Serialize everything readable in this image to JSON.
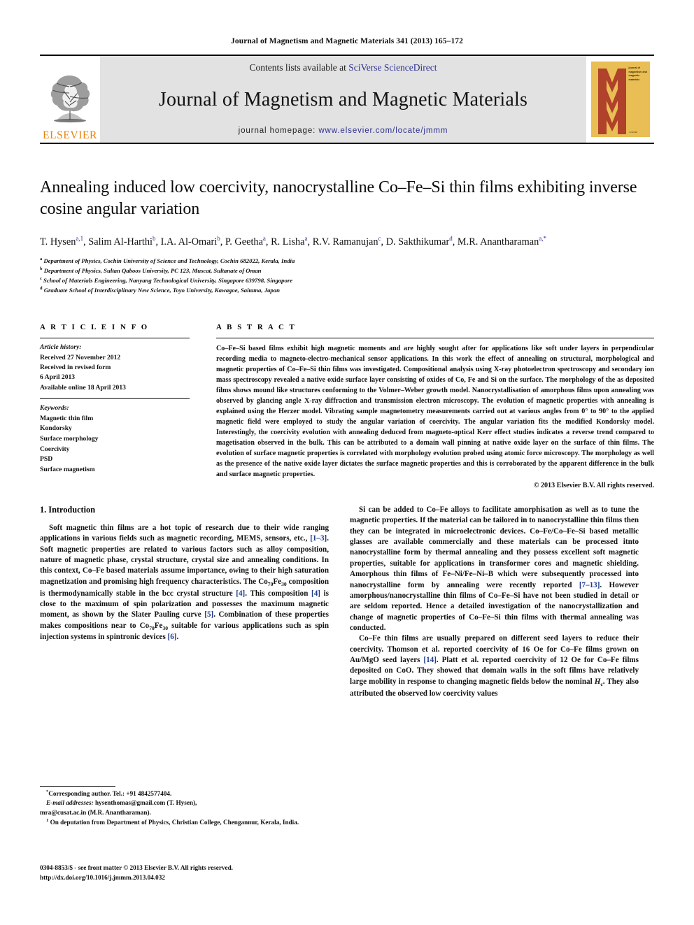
{
  "running_head": "Journal of Magnetism and Magnetic Materials 341 (2013) 165–172",
  "masthead": {
    "publisher_name": "ELSEVIER",
    "contents_prefix": "Contents lists available at ",
    "contents_link": "SciVerse ScienceDirect",
    "journal_title": "Journal of Magnetism and Magnetic Materials",
    "homepage_label": "journal homepage: ",
    "homepage_url": "www.elsevier.com/locate/jmmm",
    "cover_text": "journal of magnetism and magnetic materials",
    "cover_bottom_text": "ELSEVIER",
    "cover_bg": "#E8BE55",
    "cover_mark": "#B0412A"
  },
  "article": {
    "title": "Annealing induced low coercivity, nanocrystalline Co–Fe–Si thin films exhibiting inverse cosine angular variation",
    "authors_line_1": "T. Hysen",
    "authors": [
      {
        "name": "T. Hysen",
        "marks": "a,1"
      },
      {
        "name": "Salim Al-Harthi",
        "marks": "b"
      },
      {
        "name": "I.A. Al-Omari",
        "marks": "b"
      },
      {
        "name": "P. Geetha",
        "marks": "a"
      },
      {
        "name": "R. Lisha",
        "marks": "a"
      },
      {
        "name": "R.V. Ramanujan",
        "marks": "c"
      },
      {
        "name": "D. Sakthikumar",
        "marks": "d"
      },
      {
        "name": "M.R. Anantharaman",
        "marks": "a,*"
      }
    ],
    "affiliations": [
      {
        "mark": "a",
        "text": "Department of Physics, Cochin University of Science and Technology, Cochin 682022, Kerala, India"
      },
      {
        "mark": "b",
        "text": "Department of Physics, Sultan Qaboos University, PC 123, Muscat, Sultanate of Oman"
      },
      {
        "mark": "c",
        "text": "School of Materials Engineering, Nanyang Technological University, Singapore 639798, Singapore"
      },
      {
        "mark": "d",
        "text": "Graduate School of Interdisciplinary New Science, Toyo University, Kawagoe, Saitama, Japan"
      }
    ]
  },
  "article_info": {
    "heading": "A R T I C L E   I N F O",
    "history_label": "Article history:",
    "history": [
      "Received 27 November 2012",
      "Received in revised form",
      "6 April 2013",
      "Available online 18 April 2013"
    ],
    "keywords_label": "Keywords:",
    "keywords": [
      "Magnetic thin film",
      "Kondorsky",
      "Surface morphology",
      "Coercivity",
      "PSD",
      "Surface magnetism"
    ]
  },
  "abstract": {
    "heading": "A B S T R A C T",
    "text": "Co–Fe–Si based films exhibit high magnetic moments and are highly sought after for applications like soft under layers in perpendicular recording media to magneto-electro-mechanical sensor applications. In this work the effect of annealing on structural, morphological and magnetic properties of Co–Fe–Si thin films was investigated. Compositional analysis using X-ray photoelectron spectroscopy and secondary ion mass spectroscopy revealed a native oxide surface layer consisting of oxides of Co, Fe and Si on the surface. The morphology of the as deposited films shows mound like structures conforming to the Volmer–Weber growth model. Nanocrystallisation of amorphous films upon annealing was observed by glancing angle X-ray diffraction and transmission electron microscopy. The evolution of magnetic properties with annealing is explained using the Herzer model. Vibrating sample magnetometry measurements carried out at various angles from 0° to 90° to the applied magnetic field were employed to study the angular variation of coercivity. The angular variation fits the modified Kondorsky model. Interestingly, the coercivity evolution with annealing deduced from magneto-optical Kerr effect studies indicates a reverse trend compared to magetisation observed in the bulk. This can be attributed to a domain wall pinning at native oxide layer on the surface of thin films. The evolution of surface magnetic properties is correlated with morphology evolution probed using atomic force microscopy. The morphology as well as the presence of the native oxide layer dictates the surface magnetic properties and this is corroborated by the apparent difference in the bulk and surface magnetic properties.",
    "copyright": "© 2013 Elsevier B.V. All rights reserved."
  },
  "body": {
    "section_heading": "1.  Introduction",
    "left_p1_a": "Soft magnetic thin films are a hot topic of research due to their wide ranging applications in various fields such as magnetic recording, MEMS, sensors, etc., ",
    "left_p1_ref1": "[1–3]",
    "left_p1_b": ". Soft magnetic properties are related to various factors such as alloy composition, nature of magnetic phase, crystal structure, crystal size and annealing conditions. In this context, Co–Fe based materials assume importance, owing to their high saturation magnetization and promising high frequency characteristics. The Co",
    "left_sub70": "70",
    "left_p1_c": "Fe",
    "left_sub30": "30",
    "left_p1_d": " composition is thermodynamically stable in the bcc crystal structure ",
    "left_ref4a": "[4]",
    "left_p1_e": ". This composition ",
    "left_ref4b": "[4]",
    "left_p1_f": " is close to the maximum of spin polarization and possesses the maximum magnetic moment, as shown by the Slater Pauling curve ",
    "left_ref5": "[5]",
    "left_p1_g": ". Combination of these properties makes compositions near to Co",
    "left_p1_h": "Fe",
    "left_p1_i": " suitable for various applications such as spin injection systems in spintronic devices ",
    "left_ref6": "[6]",
    "left_p1_j": ".",
    "right_p1_a": "Si can be added to Co–Fe alloys to facilitate amorphisation as well as to tune the magnetic properties. If the material can be tailored in to nanocrystalline thin films then they can be integrated in microelectronic devices. Co–Fe/Co–Fe–Si based metallic glasses are available commercially and these materials can be processed itnto nanocrystalline form by thermal annealing and they possess excellent soft magnetic properties, suitable for applications in transformer cores and magnetic shielding. Amorphous thin films of Fe–Ni/Fe–Ni–B which were subsequently processed into nanocrystalline form by annealing were recently reported ",
    "right_ref713": "[7–13]",
    "right_p1_b": ". However amorphous/nanocrystalline thin films of Co–Fe–Si have not been studied in detail or are seldom reported. Hence a detailed investigation of the nanocrystallization and change of magnetic properties of Co–Fe–Si thin films with thermal annealing was conducted.",
    "right_p2_a": "Co–Fe thin films are usually prepared on different seed layers to reduce their coercivity. Thomson et al. reported coercivity of 16 Oe for Co–Fe films grown on Au/MgO seed layers ",
    "right_ref14": "[14]",
    "right_p2_b": ". Platt et al. reported coercivity of 12 Oe for Co–Fe films deposited on CoO. They showed that domain walls in the soft films have relatively large mobility in response to changing magnetic fields below the nominal ",
    "right_hc": "H",
    "right_hc_sub": "c",
    "right_p2_c": ". They also attributed the observed low coercivity values"
  },
  "footnotes": {
    "corresponding": "Corresponding author. Tel.: +91 4842577404.",
    "email_label": "E-mail addresses:",
    "email_1": " hysenthomas@gmail.com (T. Hysen),",
    "email_2": "mra@cusat.ac.in (M.R. Anantharaman).",
    "deputation_mark": "1",
    "deputation": "On deputation from Department of Physics, Christian College, Chengannur, Kerala, India."
  },
  "imprint": {
    "issn_line": "0304-8853/$ - see front matter © 2013 Elsevier B.V. All rights reserved.",
    "doi_line": "http://dx.doi.org/10.1016/j.jmmm.2013.04.032"
  }
}
